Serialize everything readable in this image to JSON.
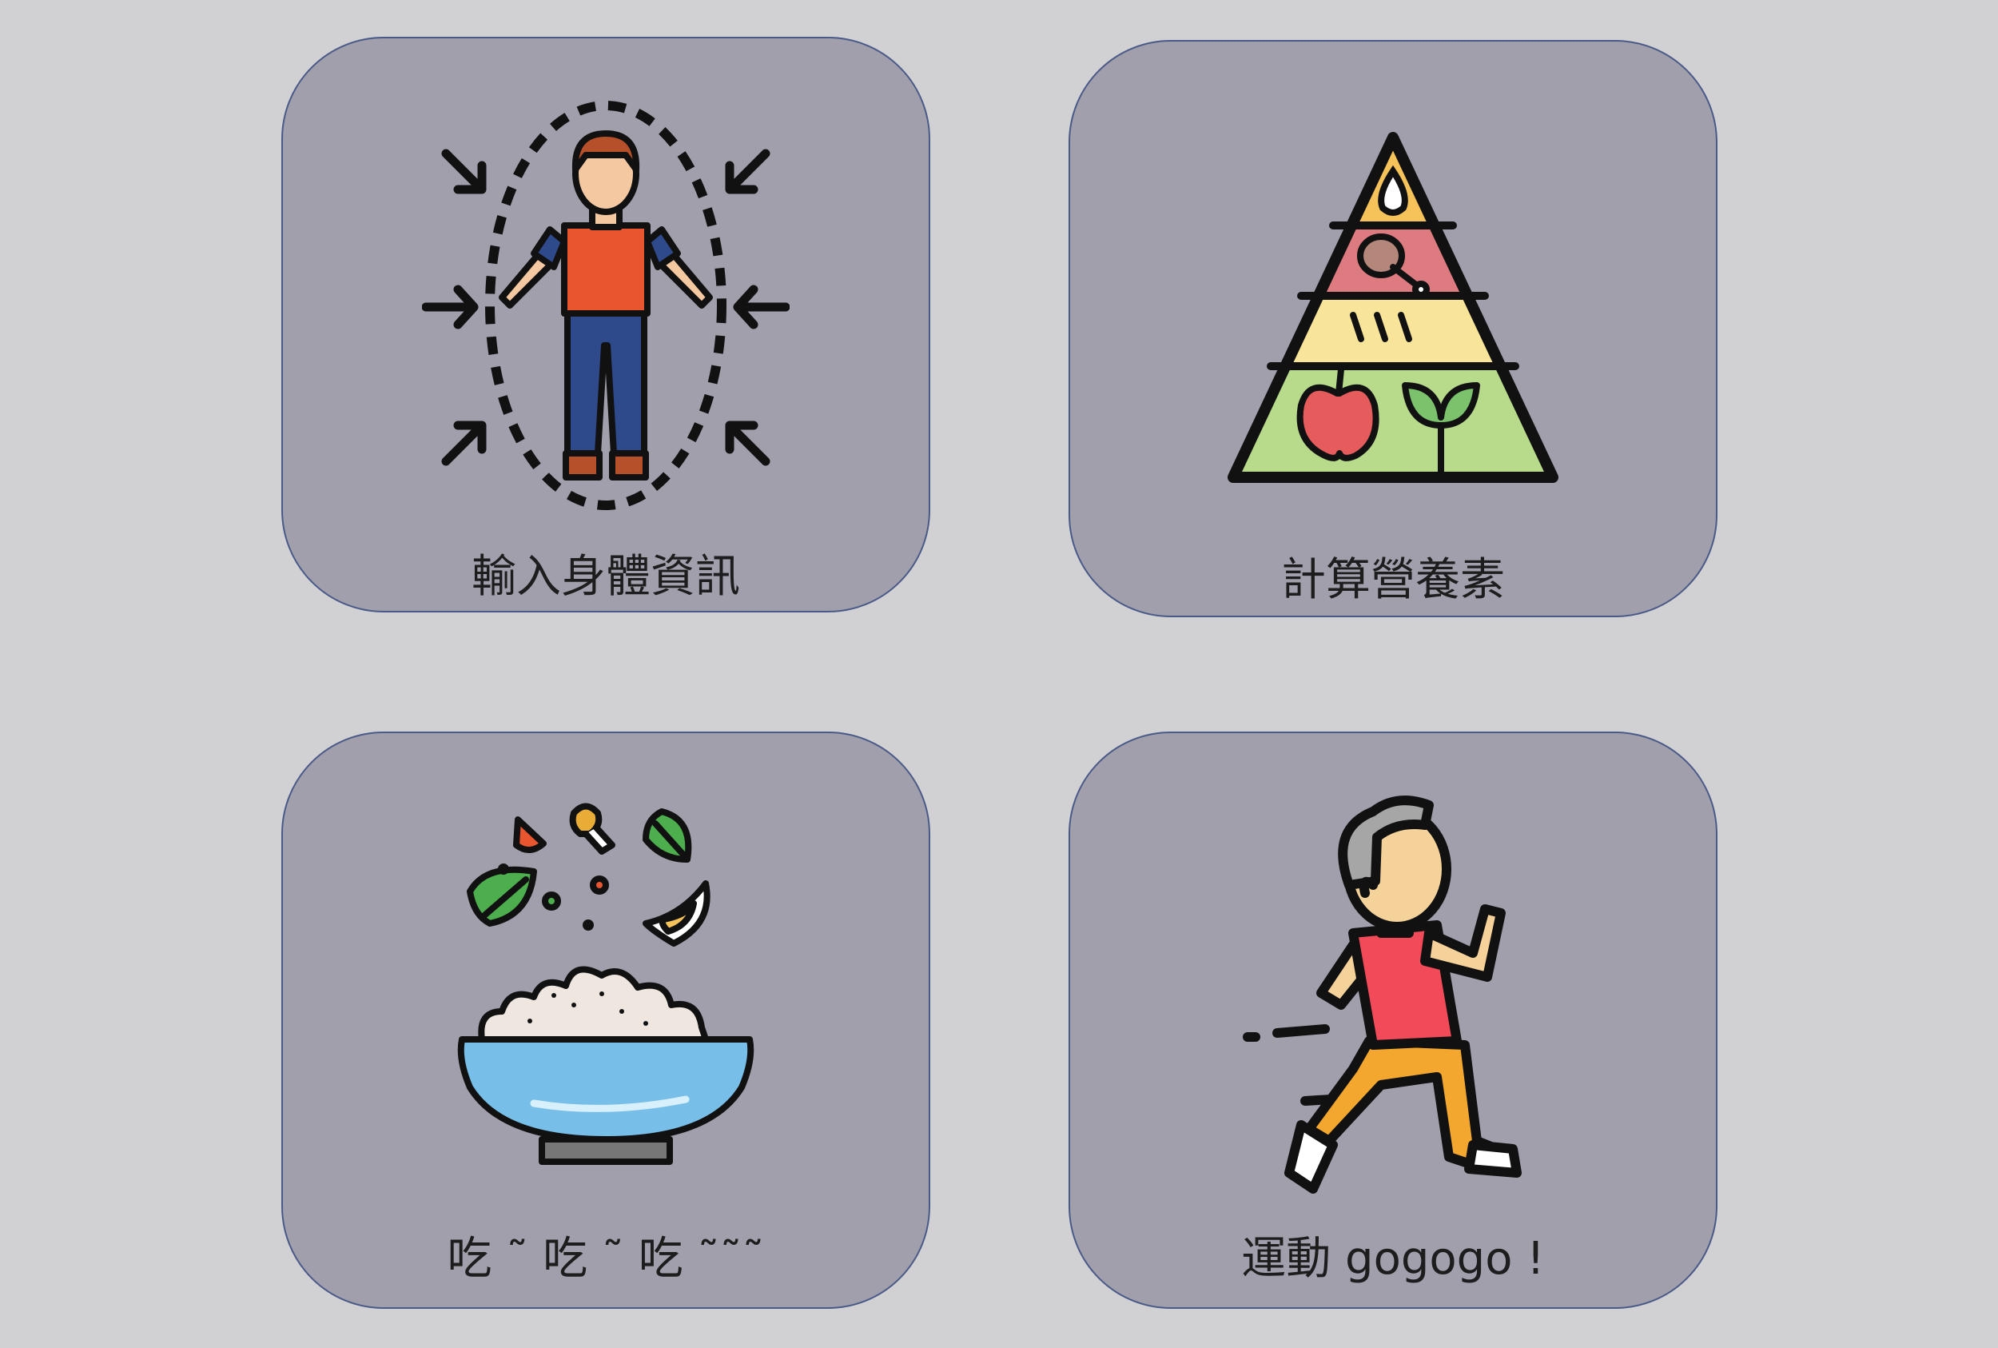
{
  "cards": [
    {
      "label": "輸入身體資訊",
      "icon": "body-measure-icon"
    },
    {
      "label": "計算營養素",
      "icon": "food-pyramid-icon"
    },
    {
      "label": "吃 ˜ 吃 ˜ 吃 ˜˜˜",
      "icon": "salad-bowl-icon"
    },
    {
      "label": "運動 gogogo !",
      "icon": "running-person-icon"
    }
  ],
  "colors": {
    "background": "#d1d0d2",
    "card": "#a09fab",
    "card_border": "#4a5a88"
  }
}
